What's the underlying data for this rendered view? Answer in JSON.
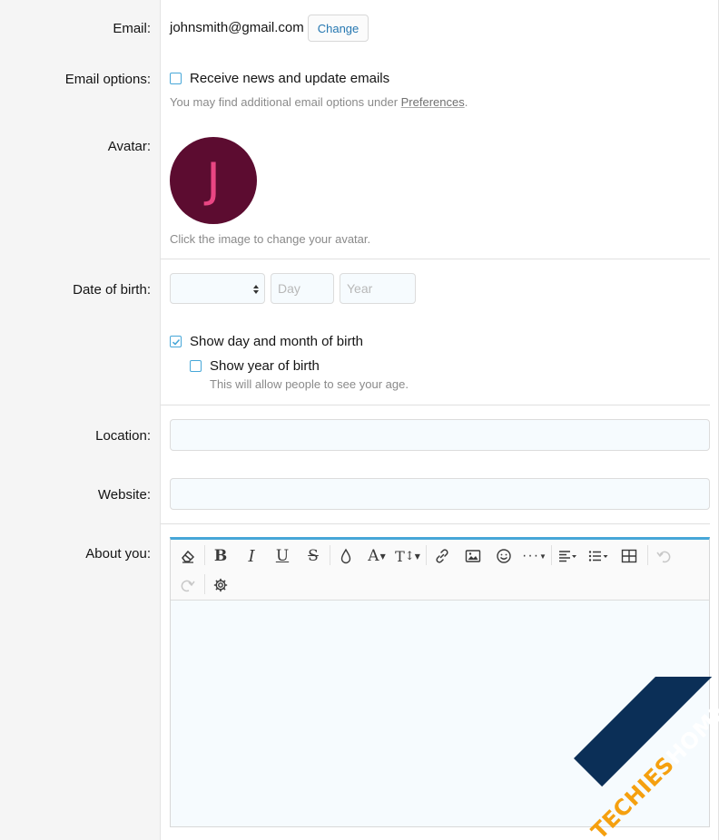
{
  "email": {
    "label": "Email:",
    "value": "johnsmith@gmail.com",
    "change_label": "Change"
  },
  "email_options": {
    "label": "Email options:",
    "checkbox_label": "Receive news and update emails",
    "checked": false,
    "hint_prefix": "You may find additional email options under ",
    "hint_link": "Preferences",
    "hint_suffix": "."
  },
  "avatar": {
    "label": "Avatar:",
    "initial": "J",
    "hint": "Click the image to change your avatar.",
    "bg_color": "#5c0c30",
    "fg_color": "#e94683"
  },
  "dob": {
    "label": "Date of birth:",
    "month_value": "",
    "day_placeholder": "Day",
    "year_placeholder": "Year",
    "show_day_month_label": "Show day and month of birth",
    "show_day_month_checked": true,
    "show_year_label": "Show year of birth",
    "show_year_checked": false,
    "show_year_hint": "This will allow people to see your age."
  },
  "location": {
    "label": "Location:",
    "value": ""
  },
  "website": {
    "label": "Website:",
    "value": ""
  },
  "about": {
    "label": "About you:",
    "toolbar": [
      "eraser-icon",
      "bold-icon",
      "italic-icon",
      "underline-icon",
      "strikethrough-icon",
      "color-drop-icon",
      "font-family-icon",
      "font-size-icon",
      "link-icon",
      "image-icon",
      "smiley-icon",
      "more-icon",
      "align-icon",
      "list-icon",
      "table-icon",
      "undo-icon",
      "redo-icon",
      "settings-gear-icon"
    ]
  },
  "watermark": {
    "text_orange": "TECHIES",
    "text_white": "HOME.COM",
    "band_color": "#0b2f57",
    "orange": "#f5a00f"
  },
  "colors": {
    "accent": "#47a7d8",
    "link": "#2577b1"
  }
}
